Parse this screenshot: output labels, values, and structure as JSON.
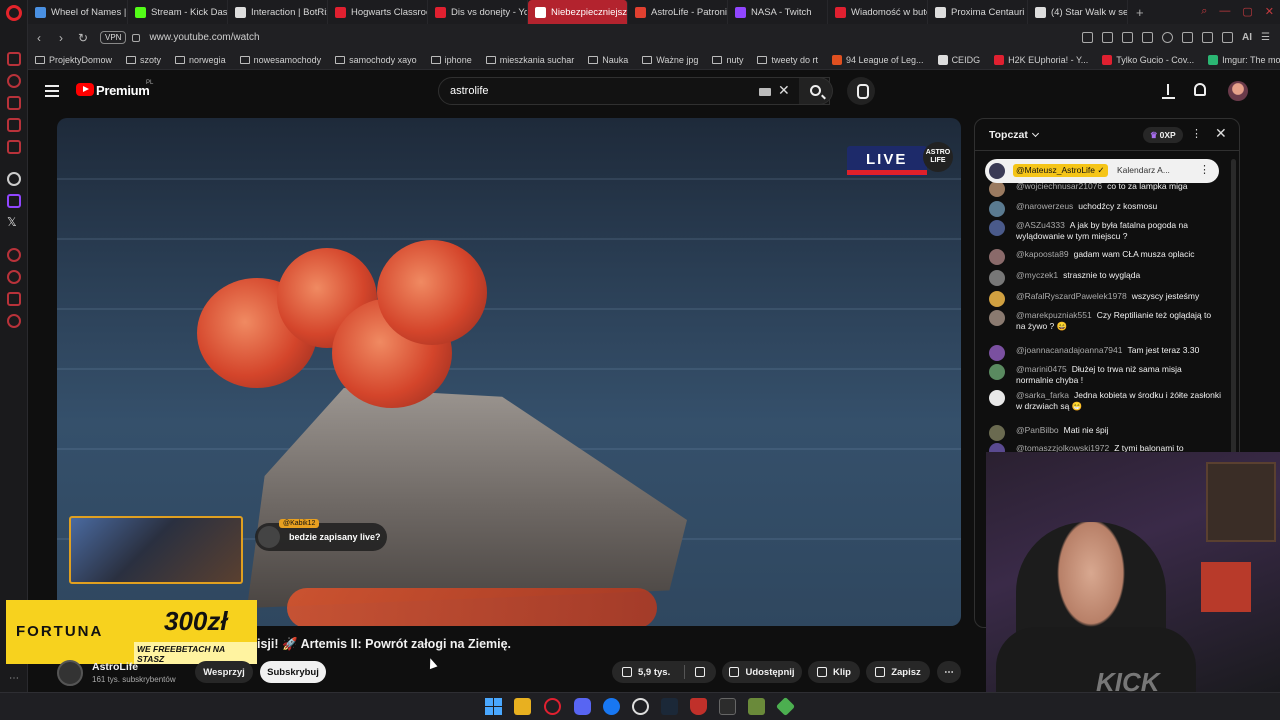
{
  "browser": {
    "tabs": [
      {
        "label": "Wheel of Names | R",
        "color": "#4a90e2",
        "active": false
      },
      {
        "label": "Stream - Kick Dash",
        "color": "#53fc18",
        "active": false
      },
      {
        "label": "Interaction | BotRix",
        "color": "#dddddd",
        "active": false
      },
      {
        "label": "Hogwarts Classroo",
        "color": "#e02030",
        "active": false
      },
      {
        "label": "Dis vs donejty - Yo",
        "color": "#e02030",
        "active": false
      },
      {
        "label": "Niebezpieczniejszy",
        "color": "#ffffff",
        "active": true
      },
      {
        "label": "AstroLife - Patronite",
        "color": "#e04030",
        "active": false
      },
      {
        "label": "NASA - Twitch",
        "color": "#9146ff",
        "active": false
      },
      {
        "label": "Wiadomość w butelce",
        "color": "#e02030",
        "active": false
      },
      {
        "label": "Proxima Centauri b",
        "color": "#dddddd",
        "active": false
      },
      {
        "label": "(4) Star Walk w se",
        "color": "#dddddd",
        "active": false
      }
    ],
    "url": "www.youtube.com/watch",
    "vpn_label": "VPN",
    "ai_label": "AI",
    "bookmarks": [
      {
        "label": "ProjektyDomow",
        "type": "folder"
      },
      {
        "label": "szoty",
        "type": "folder"
      },
      {
        "label": "norwegia",
        "type": "folder"
      },
      {
        "label": "nowesamochody",
        "type": "folder"
      },
      {
        "label": "samochody xayo",
        "type": "folder"
      },
      {
        "label": "iphone",
        "type": "folder"
      },
      {
        "label": "mieszkania suchar",
        "type": "folder"
      },
      {
        "label": "Nauka",
        "type": "folder"
      },
      {
        "label": "Ważne jpg",
        "type": "folder"
      },
      {
        "label": "nuty",
        "type": "folder"
      },
      {
        "label": "tweety do rt",
        "type": "folder"
      },
      {
        "label": "94 League of Leg...",
        "type": "site",
        "color": "#e05020"
      },
      {
        "label": "CEIDG",
        "type": "site",
        "color": "#dddddd"
      },
      {
        "label": "H2K EUphoria! - Y...",
        "type": "site",
        "color": "#e02030"
      },
      {
        "label": "Tylko Gucio - Cov...",
        "type": "site",
        "color": "#e02030"
      },
      {
        "label": "Imgur: The most a...",
        "type": "site",
        "color": "#2bb673"
      }
    ]
  },
  "youtube": {
    "brand": "Premium",
    "region": "PL",
    "search_value": "astrolife",
    "video": {
      "live_label": "LIVE",
      "logo_text": "ASTRO LIFE",
      "popup_user": "@Kabik12",
      "popup_text": "bedzie zapisany live?",
      "title": "isji! 🚀 Artemis II: Powrót załogi na Ziemię.",
      "channel_name": "AstroLife",
      "channel_subs": "161 tys. subskrybentów",
      "support_label": "Wesprzyj",
      "subscribe_label": "Subskrybuj",
      "like_count": "5,9 tys.",
      "share_label": "Udostępnij",
      "clip_label": "Klip",
      "save_label": "Zapisz",
      "more_label": "⋯"
    },
    "ad": {
      "brand": "FORTUNA",
      "amount": "300zł",
      "tagline": "WE FREEBETACH NA STASZ"
    },
    "chat": {
      "mode": "Topczat",
      "xp": "0XP",
      "pinned": {
        "user": "@Mateusz_AstroLife ✓",
        "text": "Kalendarz A..."
      },
      "messages": [
        {
          "user": "@wojciechnusar21076",
          "text": "co to za lampka miga",
          "color": "#9a7a60"
        },
        {
          "user": "@narowerzeus",
          "text": "uchodźcy z kosmosu",
          "color": "#5a7a90"
        },
        {
          "user": "@ASZu4333",
          "text": "A jak by była fatalna pogoda na wylądowanie w tym miejscu ?",
          "color": "#4a5a8a"
        },
        {
          "user": "@kapoosta89",
          "text": "gadam wam CŁA musza oplacic",
          "color": "#8a6a6a"
        },
        {
          "user": "@myczek1",
          "text": "strasznie to wygląda",
          "color": "#777777"
        },
        {
          "user": "@RafalRyszardPawelek1978",
          "text": "wszyscy jesteśmy",
          "color": "#d0a040"
        },
        {
          "user": "@marekpuzniak551",
          "text": "Czy Reptilianie też oglądają to na żywo ? 😄",
          "color": "#8a7a70"
        },
        {
          "user": "@joannacanadajoanna7941",
          "text": "Tam jest teraz 3.30",
          "color": "#7a50a0"
        },
        {
          "user": "@marini0475",
          "text": "Dłużej to trwa niż sama misja normalnie chyba !",
          "color": "#5a8a60"
        },
        {
          "user": "@sarka_farka",
          "text": "Jedna kobieta w środku i żółte zasłonki w drzwiach są 😁",
          "color": "#e8e8e8"
        },
        {
          "user": "@PanBilbo",
          "text": "Mati nie śpij",
          "color": "#6a6a50"
        },
        {
          "user": "@tomaszzjolkowski1972",
          "text": "Z tymi balonami to",
          "color": "#5a4a90"
        }
      ]
    }
  },
  "stream_overlay": {
    "kick_text": "KICK"
  }
}
